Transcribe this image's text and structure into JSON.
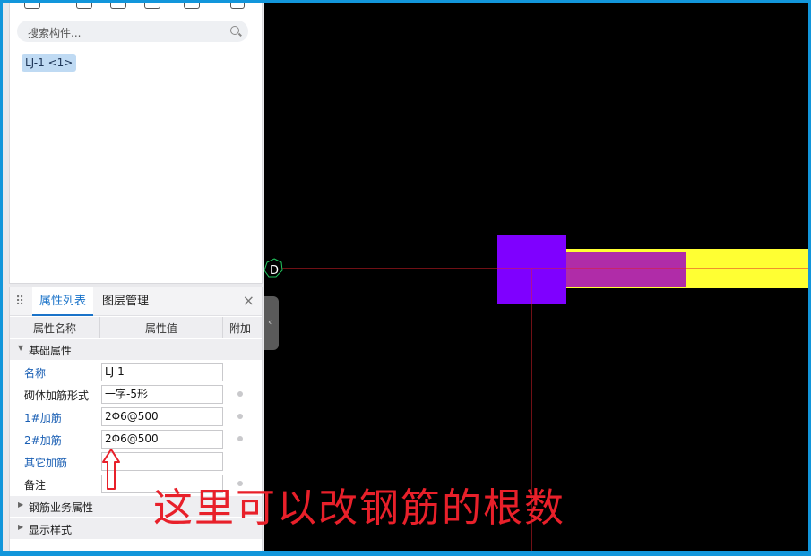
{
  "search": {
    "placeholder": "搜索构件..."
  },
  "component": {
    "chip_label": "LJ-1 <1>"
  },
  "properties_panel": {
    "tabs": [
      {
        "label": "属性列表"
      },
      {
        "label": "图层管理"
      }
    ],
    "close": "×",
    "columns": {
      "name": "属性名称",
      "value": "属性值",
      "extra": "附加"
    },
    "groups": [
      {
        "label": "基础属性"
      },
      {
        "label": "钢筋业务属性"
      },
      {
        "label": "显示样式"
      }
    ],
    "rows": [
      {
        "name": "名称",
        "value": "LJ-1"
      },
      {
        "name": "砌体加筋形式",
        "value": "一字-5形"
      },
      {
        "name": "1#加筋",
        "value": "2Φ6@500"
      },
      {
        "name": "2#加筋",
        "value": "2Φ6@500"
      },
      {
        "name": "其它加筋",
        "value": ""
      },
      {
        "name": "备注",
        "value": ""
      }
    ]
  },
  "cad": {
    "axis_label": "D",
    "annotation": "这里可以改钢筋的根数",
    "colors": {
      "column": "#7f00ff",
      "wall": "#ffff33",
      "rebar": "#b02ca8",
      "axis": "#e0202a",
      "axis_bubble": "#22c55e"
    }
  }
}
